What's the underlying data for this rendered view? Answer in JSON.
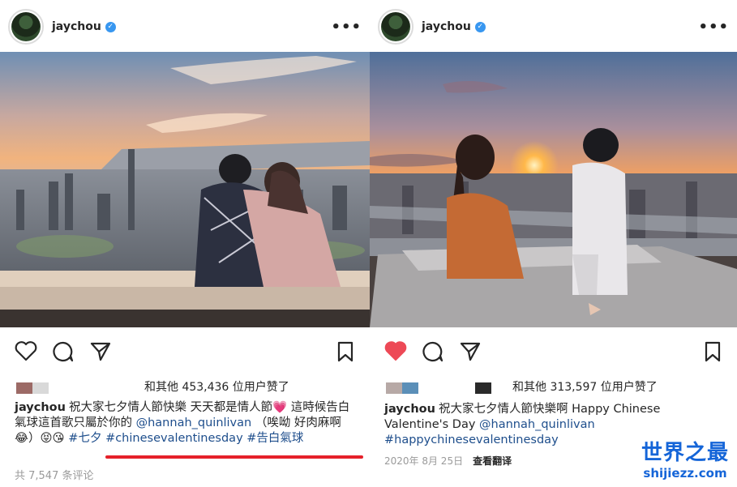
{
  "left_post": {
    "username": "jaychou",
    "verified_mark": "✓",
    "more_label": "•••",
    "likes_text": "和其他 453,436 位用户赞了",
    "caption": {
      "username": "jaychou",
      "text_1": "祝大家七夕情人節快樂 天天都是情人節💗 這時候告白氣球這首歌只屬於你的",
      "mention": "@hannah_quinlivan",
      "text_2": "（唉呦 好肉麻啊😂）😝😘",
      "hashtag_1": "#七夕",
      "hashtag_2": "#chinesevalentinesday",
      "hashtag_3": "#告白氣球"
    },
    "comments": "共 7,547 条评论",
    "liker_colors": [
      "#9c6a66",
      "#d9d9d9"
    ]
  },
  "right_post": {
    "username": "jaychou",
    "verified_mark": "✓",
    "more_label": "•••",
    "likes_text": "和其他 313,597 位用户赞了",
    "caption": {
      "username": "jaychou",
      "text_1": "祝大家七夕情人節快樂啊 Happy Chinese Valentine's Day",
      "mention": "@hannah_quinlivan",
      "hashtag_1": "#happychinesevalentinesday"
    },
    "date": "2020年 8月 25日",
    "see_translation": "查看翻译",
    "liker_colors": [
      "#b7a9a6",
      "#5b8fb8",
      "#2a2a2a"
    ]
  },
  "icons": {
    "heart": "heart-icon",
    "comment": "comment-icon",
    "share": "share-icon",
    "bookmark": "bookmark-icon",
    "heart_liked_color": "#ed4956"
  },
  "watermark": {
    "title": "世界之最",
    "url": "shijiezz.com"
  }
}
